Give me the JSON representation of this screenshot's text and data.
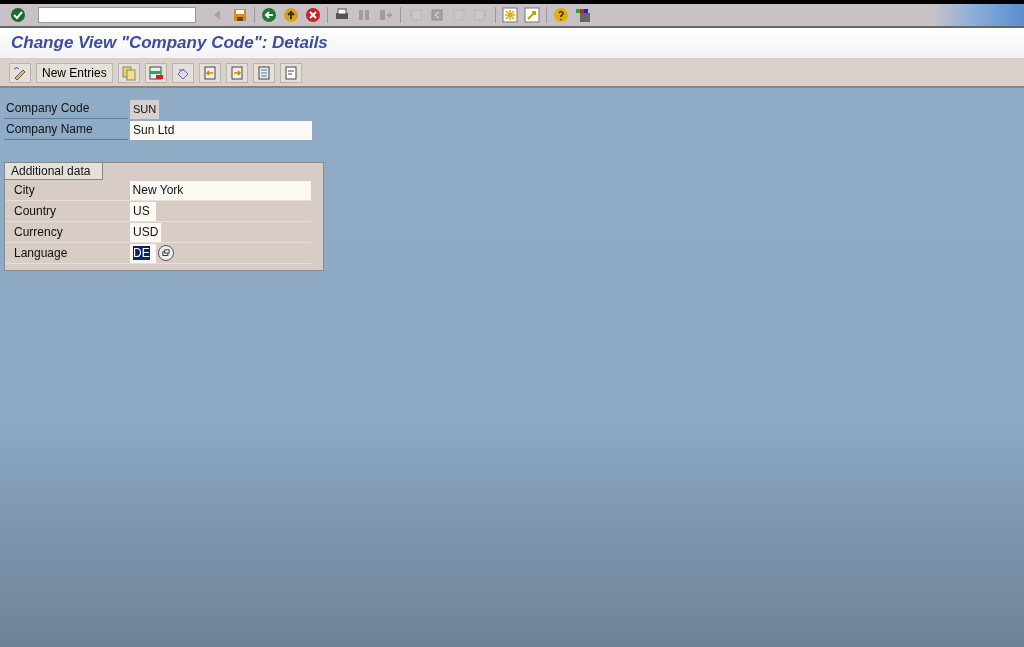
{
  "system_toolbar": {
    "buttons": [
      {
        "disabled": true
      },
      {
        "disabled": false
      },
      {
        "disabled": false
      },
      {
        "disabled": false
      },
      {
        "disabled": false
      },
      {
        "disabled": false
      },
      {
        "disabled": true
      },
      {
        "disabled": true
      },
      {
        "disabled": true
      },
      {
        "disabled": true
      },
      {
        "disabled": true
      },
      {
        "disabled": true
      },
      {
        "disabled": false
      },
      {
        "disabled": false
      },
      {
        "disabled": false
      },
      {
        "disabled": false
      }
    ]
  },
  "title": "Change View \"Company Code\": Details",
  "app_toolbar": {
    "text_button": "New Entries"
  },
  "header_fields": [
    {
      "label": "Company Code",
      "value": "SUN",
      "kind": "short",
      "readonly": true,
      "selected": false
    },
    {
      "label": "Company Name",
      "value": "Sun Ltd",
      "kind": "long",
      "readonly": false,
      "selected": false
    }
  ],
  "group": {
    "title": "Additional data",
    "fields": [
      {
        "label": "City",
        "value": "New York",
        "kind": "long",
        "readonly": false,
        "selected": false
      },
      {
        "label": "Country",
        "value": "US",
        "kind": "short",
        "readonly": false,
        "selected": false
      },
      {
        "label": "Currency",
        "value": "USD",
        "kind": "short",
        "readonly": false,
        "selected": false
      },
      {
        "label": "Language",
        "value": "DE",
        "kind": "help",
        "readonly": false,
        "selected": true
      }
    ]
  }
}
